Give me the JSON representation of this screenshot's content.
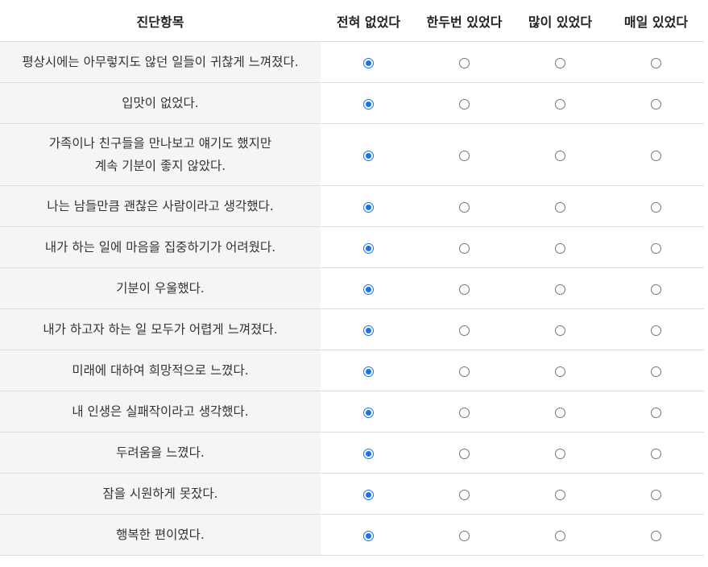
{
  "header": {
    "item_label": "진단항목",
    "options": [
      "전혀 없었다",
      "한두번 있었다",
      "많이 있었다",
      "매일 있었다"
    ]
  },
  "questions": [
    {
      "lines": [
        "평상시에는 아무렇지도 않던 일들이 귀찮게 느껴졌다."
      ],
      "selected": 0
    },
    {
      "lines": [
        "입맛이 없었다."
      ],
      "selected": 0
    },
    {
      "lines": [
        "가족이나 친구들을 만나보고 얘기도 했지만",
        "계속 기분이 좋지 않았다."
      ],
      "selected": 0
    },
    {
      "lines": [
        "나는 남들만큼 괜찮은 사람이라고 생각했다."
      ],
      "selected": 0
    },
    {
      "lines": [
        "내가 하는 일에 마음을 집중하기가 어려웠다."
      ],
      "selected": 0
    },
    {
      "lines": [
        "기분이 우울했다."
      ],
      "selected": 0
    },
    {
      "lines": [
        "내가 하고자 하는 일 모두가 어렵게 느껴졌다."
      ],
      "selected": 0
    },
    {
      "lines": [
        "미래에 대하여 희망적으로 느꼈다."
      ],
      "selected": 0
    },
    {
      "lines": [
        "내 인생은 실패작이라고 생각했다."
      ],
      "selected": 0
    },
    {
      "lines": [
        "두려움을 느꼈다."
      ],
      "selected": 0
    },
    {
      "lines": [
        "잠을 시원하게 못잤다."
      ],
      "selected": 0
    },
    {
      "lines": [
        "행복한 편이였다."
      ],
      "selected": 0
    }
  ],
  "colors": {
    "accent": "#1a73e8",
    "item_background": "#f5f5f5",
    "row_border": "#dcdcdc"
  }
}
